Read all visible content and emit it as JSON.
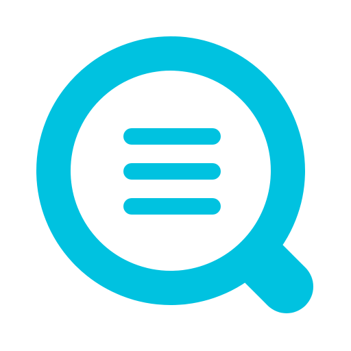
{
  "icon": {
    "name": "search-list-icon",
    "accent_color": "#00C2E0",
    "background_color": "#FFFFFF",
    "list_lines": 3
  }
}
